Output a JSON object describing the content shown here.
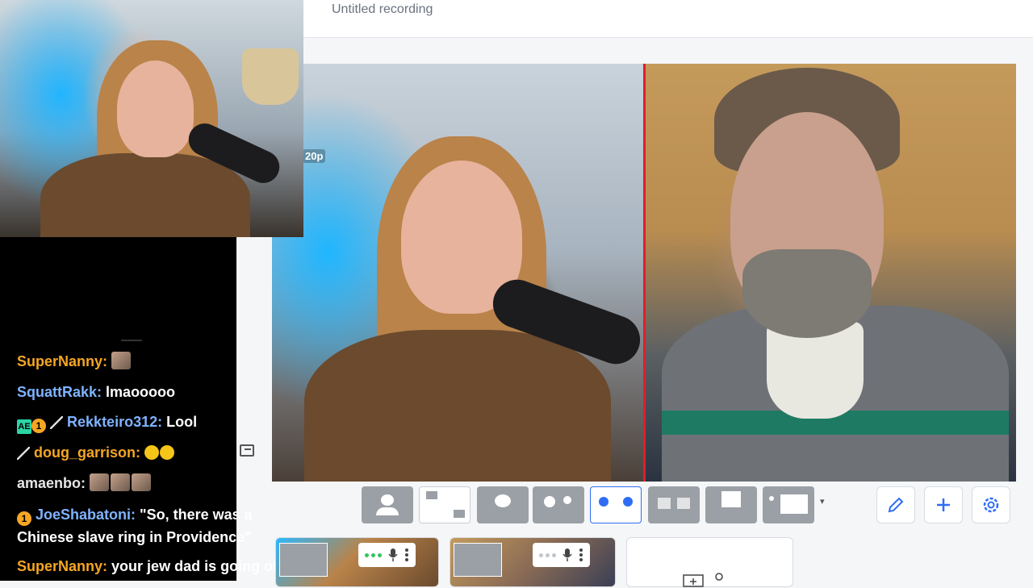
{
  "recording": {
    "title": "Untitled recording"
  },
  "stage": {
    "resolution_badge": "20p"
  },
  "chat": {
    "messages": [
      {
        "user": "SuperNanny:",
        "text": "",
        "emotes": 1,
        "user_color": "orange"
      },
      {
        "user": "SquattRakk:",
        "text": "lmaooooo",
        "user_color": "blue"
      },
      {
        "user": "Rekkteiro312:",
        "text": "Lool",
        "user_color": "blue",
        "badges": [
          "AE",
          "1",
          "knife"
        ]
      },
      {
        "user": "doug_garrison:",
        "text": "",
        "user_color": "orange",
        "badges": [
          "knife"
        ],
        "emojis": 2
      },
      {
        "user": "amaenbo:",
        "text": "",
        "user_color": "white",
        "emotes": 3
      },
      {
        "user": "JoeShabatoni:",
        "text": "\"So, there was a Chinese slave ring in Providence\"",
        "user_color": "blue",
        "badges": [
          "1"
        ]
      },
      {
        "user": "SuperNanny:",
        "text": "your jew dad is going off",
        "user_color": "orange"
      }
    ]
  },
  "toolbar": {
    "layouts": [
      "single",
      "grid-4",
      "presenter-3",
      "single-plus-2",
      "side-by-side",
      "two-small",
      "screen",
      "list-screen"
    ],
    "active_layout": "side-by-side",
    "tools": [
      "pencil-icon",
      "plus-icon",
      "gear-icon"
    ]
  },
  "colors": {
    "accent": "#2f6df6",
    "active_speaker": "#e11d2e",
    "mic_level": "#36c45e"
  }
}
